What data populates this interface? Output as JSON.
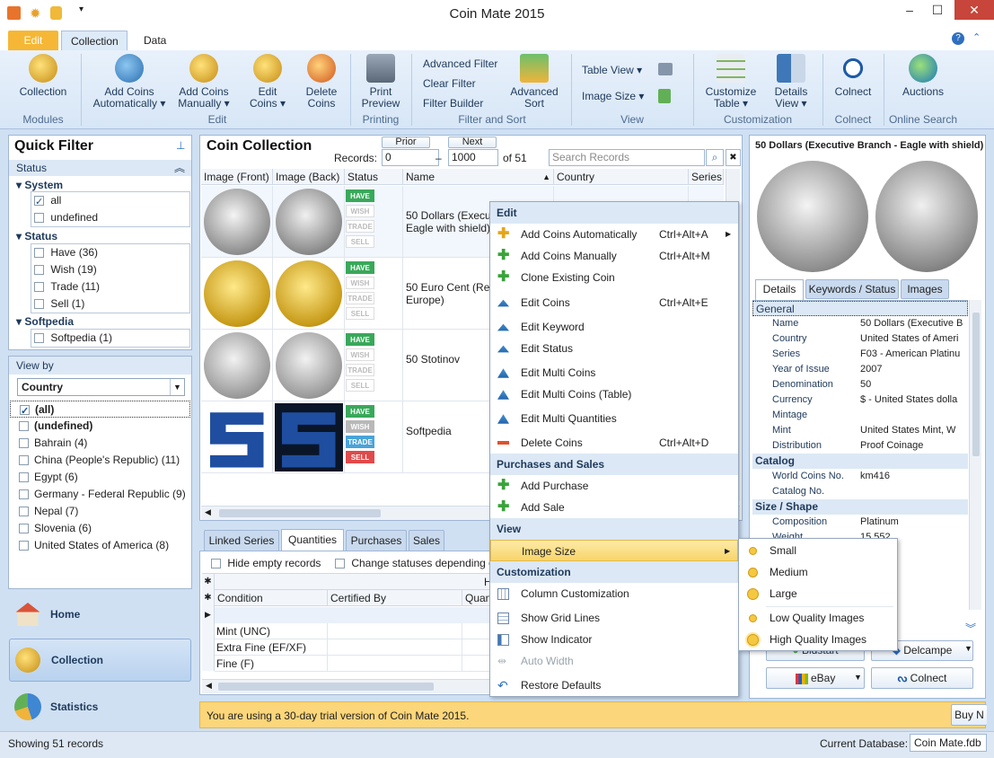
{
  "window": {
    "title": "Coin Mate 2015"
  },
  "ribbon_tabs": [
    "Edit",
    "Collection",
    "Data"
  ],
  "ribbon": {
    "collection": "Collection",
    "modules": "Modules",
    "add_auto_1": "Add Coins",
    "add_auto_2": "Automatically",
    "add_man_1": "Add Coins",
    "add_man_2": "Manually",
    "edit_1": "Edit",
    "edit_2": "Coins",
    "delete_1": "Delete",
    "delete_2": "Coins",
    "edit_group": "Edit",
    "print_1": "Print",
    "print_2": "Preview",
    "printing": "Printing",
    "advanced_filter": "Advanced Filter",
    "clear_filter": "Clear Filter",
    "filter_builder": "Filter Builder",
    "adv_sort_1": "Advanced",
    "adv_sort_2": "Sort",
    "filter_sort": "Filter and Sort",
    "table_view": "Table View",
    "image_size": "Image Size",
    "view_group": "View",
    "customize_1": "Customize",
    "customize_2": "Table",
    "details_1": "Details",
    "details_2": "View",
    "customization": "Customization",
    "colnect_btn": "Colnect",
    "colnect_group": "Colnect",
    "auctions": "Auctions",
    "online_search": "Online Search"
  },
  "quick_filter": {
    "title": "Quick Filter",
    "status_section": "Status",
    "system": "System",
    "system_items": [
      "all",
      "undefined"
    ],
    "status": "Status",
    "status_items": [
      "Have (36)",
      "Wish (19)",
      "Trade (11)",
      "Sell (1)"
    ],
    "softpedia": "Softpedia",
    "softpedia_items": [
      "Softpedia (1)"
    ]
  },
  "view_by": {
    "title": "View by",
    "select": "Country",
    "items": [
      "(all)",
      "(undefined)",
      "Bahrain  (4)",
      "China (People's Republic)  (11)",
      "Egypt  (6)",
      "Germany - Federal Republic  (9)",
      "Nepal  (7)",
      "Slovenia  (6)",
      "United States of America  (8)"
    ]
  },
  "nav": {
    "home": "Home",
    "collection": "Collection",
    "statistics": "Statistics"
  },
  "collection": {
    "title": "Coin Collection",
    "prior": "Prior",
    "next": "Next",
    "records_label": "Records:",
    "from": "0",
    "dash": "–",
    "to": "1000",
    "of": "of 51",
    "search_placeholder": "Search Records",
    "columns": [
      "Image (Front)",
      "Image (Back)",
      "Status",
      "Name",
      "Country",
      "Series"
    ],
    "rows": [
      {
        "name": "50 Dollars (Executi",
        "name2": "Eagle with shield)"
      },
      {
        "name": "50 Euro Cent (Relie",
        "name2": "Europe)"
      },
      {
        "name": "50 Stotinov",
        "name2": ""
      },
      {
        "name": "Softpedia",
        "name2": ""
      }
    ],
    "badges": {
      "have": "HAVE",
      "wish": "WISH",
      "trade": "TRADE",
      "sell": "SELL"
    }
  },
  "bottom_tabs": [
    "Linked Series",
    "Quantities",
    "Purchases",
    "Sales"
  ],
  "bottom": {
    "hide_empty": "Hide empty records",
    "change_status": "Change statuses depending o",
    "h": "H",
    "col_condition": "Condition",
    "col_certified": "Certified By",
    "col_quant": "Quant",
    "conditions": [
      "Mint (UNC)",
      "Extra Fine (EF/XF)",
      "Fine (F)"
    ]
  },
  "context_menu": {
    "sections": {
      "edit": "Edit",
      "purchases": "Purchases and Sales",
      "view": "View",
      "customization": "Customization"
    },
    "items": {
      "add_auto": "Add Coins Automatically",
      "add_auto_sc": "Ctrl+Alt+A",
      "add_man": "Add Coins Manually",
      "add_man_sc": "Ctrl+Alt+M",
      "clone": "Clone Existing Coin",
      "edit_coins": "Edit Coins",
      "edit_coins_sc": "Ctrl+Alt+E",
      "edit_keyword": "Edit Keyword",
      "edit_status": "Edit Status",
      "edit_multi": "Edit Multi Coins",
      "edit_multi_table": "Edit Multi Coins (Table)",
      "edit_multi_q": "Edit Multi Quantities",
      "delete": "Delete Coins",
      "delete_sc": "Ctrl+Alt+D",
      "add_purchase": "Add Purchase",
      "add_sale": "Add Sale",
      "image_size": "Image Size",
      "col_custom": "Column Customization",
      "grid_lines": "Show Grid Lines",
      "indicator": "Show Indicator",
      "auto_width": "Auto Width",
      "restore": "Restore Defaults"
    }
  },
  "submenu": [
    "Small",
    "Medium",
    "Large",
    "Low Quality Images",
    "High Quality Images"
  ],
  "details": {
    "title": "50 Dollars (Executive Branch - Eagle with shield)",
    "tabs": [
      "Details",
      "Keywords / Status",
      "Images"
    ],
    "general": "General",
    "fields": [
      {
        "k": "Name",
        "v": "50 Dollars (Executive B"
      },
      {
        "k": "Country",
        "v": "United States of Ameri"
      },
      {
        "k": "Series",
        "v": "F03 - American Platinu"
      },
      {
        "k": "Year of Issue",
        "v": "2007"
      },
      {
        "k": "Denomination",
        "v": "50"
      },
      {
        "k": "Currency",
        "v": "$ - United States dolla"
      },
      {
        "k": "Mintage",
        "v": ""
      },
      {
        "k": "Mint",
        "v": "United States Mint, W"
      },
      {
        "k": "Distribution",
        "v": "Proof Coinage"
      }
    ],
    "catalog": "Catalog",
    "catalog_fields": [
      {
        "k": "World Coins No.",
        "v": "km416"
      },
      {
        "k": "Catalog No.",
        "v": ""
      }
    ],
    "size_shape": "Size / Shape",
    "size_fields": [
      {
        "k": "Composition",
        "v": "Platinum"
      },
      {
        "k": "Weight",
        "v": "15.552"
      }
    ],
    "btn_bidstart": "Bidstart",
    "btn_delcampe": "Delcampe",
    "btn_ebay": "eBay",
    "btn_colnect": "Colnect"
  },
  "trial": {
    "text": "You are using a 30-day trial version of Coin Mate 2015.",
    "buy": "Buy N"
  },
  "statusbar": {
    "records": "Showing 51 records",
    "db_label": "Current Database:",
    "db_value": "Coin Mate.fdb"
  },
  "colors": {
    "accent": "#f5b735",
    "have": "#39a85a",
    "wish": "#b8b8b8",
    "trade": "#4aa3d8",
    "sell": "#e04a4a",
    "trial": "#fbd67a"
  }
}
